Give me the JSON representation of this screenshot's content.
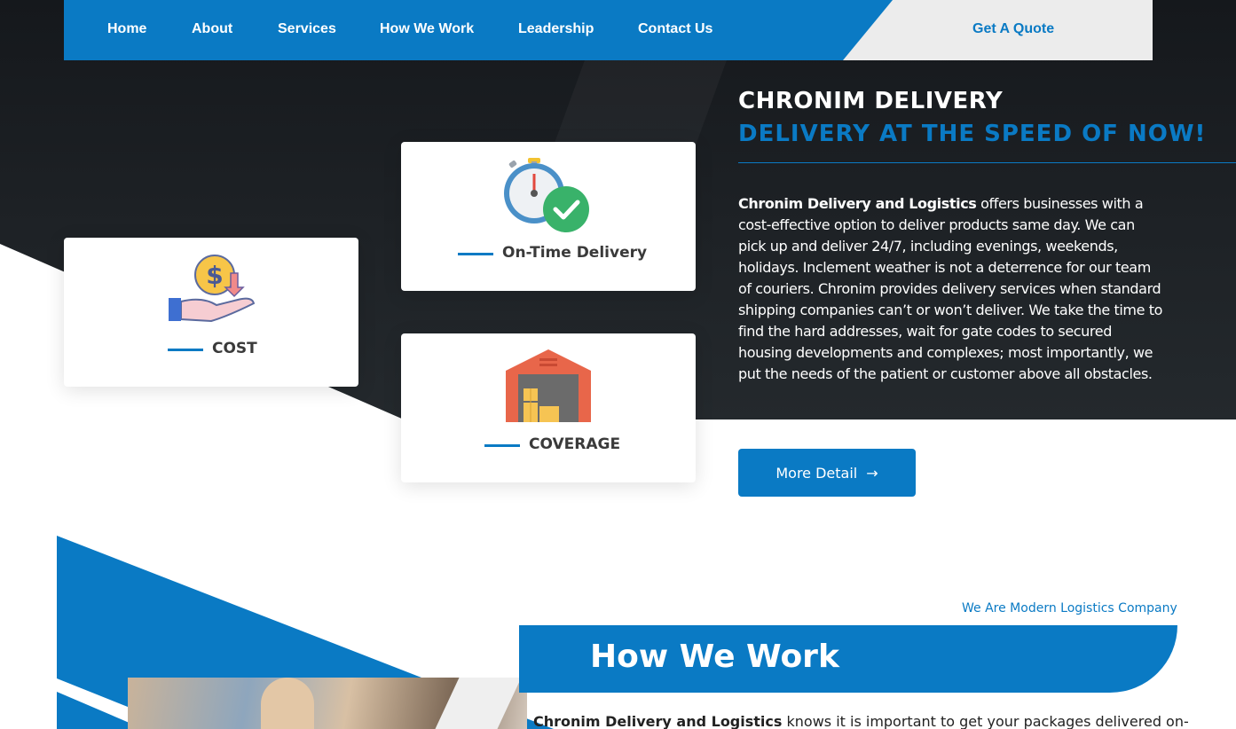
{
  "nav": {
    "items": [
      "Home",
      "About",
      "Services",
      "How We Work",
      "Leadership",
      "Contact Us"
    ],
    "quote_label": "Get A Quote"
  },
  "features": {
    "on_time": "On-Time Delivery",
    "cost": "COST",
    "coverage": "COVERAGE"
  },
  "hero": {
    "title": "CHRONIM DELIVERY",
    "subtitle": "DELIVERY AT THE SPEED OF NOW!",
    "intro_bold": "Chronim Delivery and Logistics",
    "intro_rest": " offers businesses with a cost-effective option to deliver products same day. We can pick up and deliver 24/7, including evenings, weekends, holidays. Inclement weather is not a deterrence for our team of couriers. Chronim provides delivery services when standard shipping companies can’t or won’t deliver. We take the time to find the hard addresses, wait for gate codes to secured housing developments and complexes; most importantly, we put the needs of the patient or customer above all obstacles.",
    "more_label": "More Detail",
    "more_arrow": "→"
  },
  "how": {
    "tagline": "We Are Modern Logistics Company",
    "title": "How We Work",
    "text_bold": "Chronim Delivery and Logistics",
    "text_rest": " knows it is important to get your packages delivered on-"
  },
  "colors": {
    "brand": "#0a7ac4",
    "dark": "#1e2226",
    "quote_bg": "#ececec"
  },
  "icons": [
    "stopwatch-check-icon",
    "money-hand-icon",
    "warehouse-icon",
    "arrow-right-icon"
  ]
}
